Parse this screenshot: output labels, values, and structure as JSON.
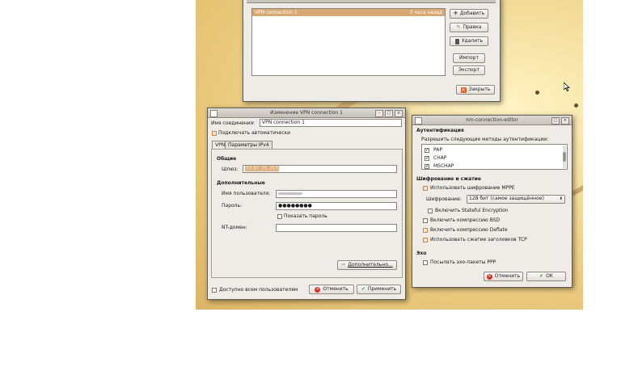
{
  "connections_window": {
    "selected_row": {
      "name": "VPN connection 1",
      "time": "3 часа назад"
    },
    "buttons": {
      "add": "Добавить",
      "edit": "Правка",
      "delete": "Удалить",
      "import": "Импорт",
      "export": "Экспорт",
      "close": "Закрыть"
    }
  },
  "vpn_editor": {
    "title": "Изменение VPN connection 1",
    "conn_name_label": "Имя соединения:",
    "conn_name_value": "VPN connection 1",
    "autoconnect_label": "Подключать автоматически",
    "tabs": [
      "VPN",
      "Параметры IPv4"
    ],
    "general_header": "Общие",
    "gateway_label": "Шлюз:",
    "gateway_value": "10.97.05.253",
    "additional_header": "Дополнительные",
    "username_label": "Имя пользователя:",
    "password_label": "Пароль:",
    "password_value": "●●●●●●●●",
    "show_password_label": "Показать пароль",
    "nt_domain_label": "NT-домен:",
    "advanced_button": "Дополнительно...",
    "all_users_label": "Доступно всем пользователям",
    "cancel_button": "Отменить",
    "apply_button": "Применить"
  },
  "ppp_dialog": {
    "title": "nm-connection-editor",
    "auth_header": "Аутентификация",
    "auth_sub": "Разрешить следующие методы аутентификации:",
    "auth_methods": [
      "PAP",
      "CHAP",
      "MSCHAP"
    ],
    "enc_header": "Шифрование и сжатие",
    "use_mppe": "Использовать шифрование MPPE",
    "encryption_label": "Шифрование:",
    "encryption_value": "128 бит (самое защищённое)",
    "stateful": "Включить Stateful Encryption",
    "bsd": "Включить компрессию BSD",
    "deflate": "Включить компрессию Deflate",
    "tcp_header_comp": "Использовать сжатие заголовков TCP",
    "echo_header": "Эхо",
    "echo_label": "Посылать эхо-пакеты PPP",
    "cancel_button": "Отменить",
    "ok_button": "OK"
  }
}
